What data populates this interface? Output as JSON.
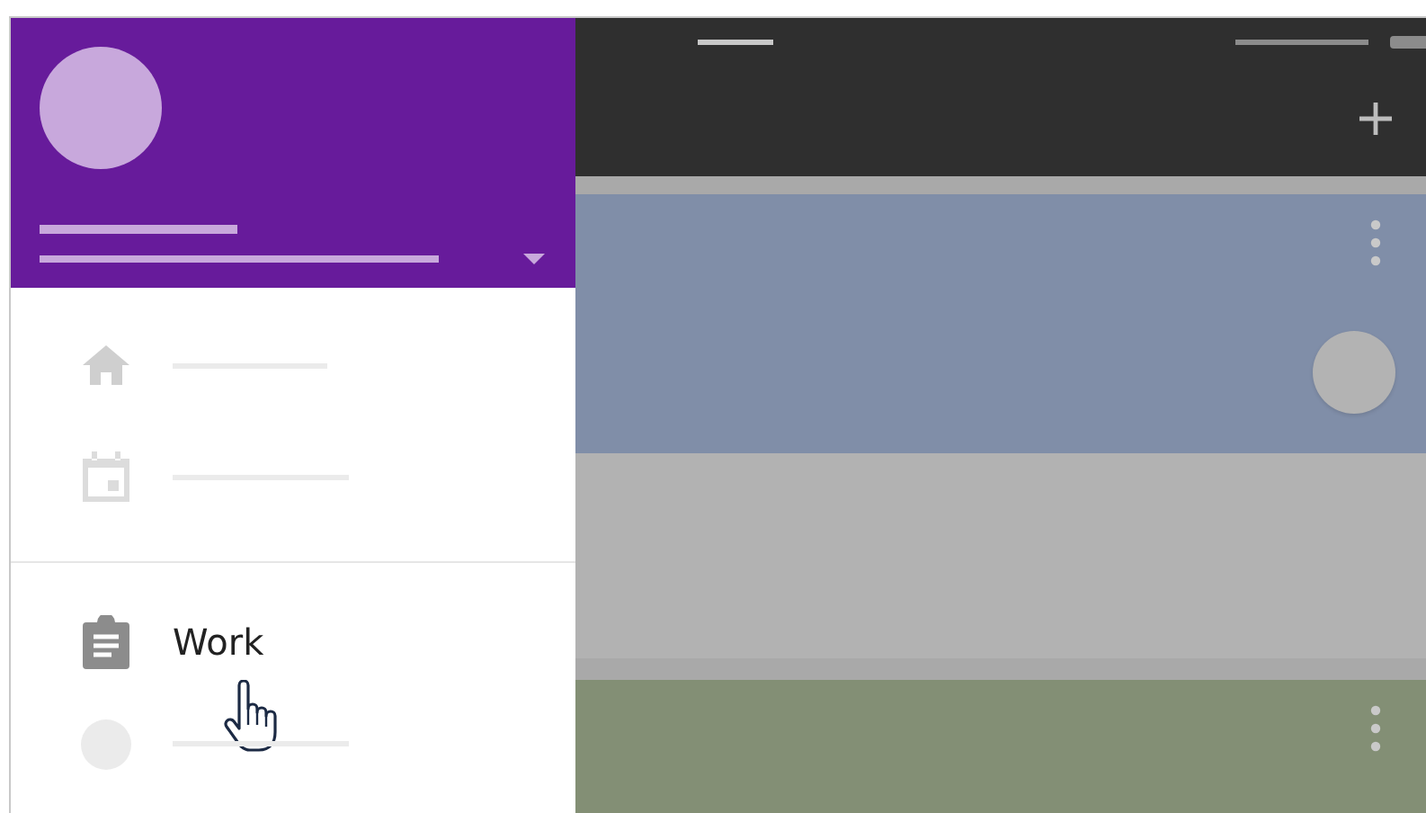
{
  "drawer": {
    "sections": [
      {
        "items": [
          {
            "kind": "home"
          },
          {
            "kind": "calendar"
          }
        ]
      },
      {
        "items": [
          {
            "kind": "clipboard",
            "label": "Work",
            "hovered": true
          },
          {
            "kind": "dot"
          }
        ]
      }
    ]
  },
  "cards": [
    {
      "color": "#808ea8",
      "menu": true,
      "avatar": true
    },
    {
      "color": "#b2b2b2",
      "menu": false,
      "avatar": false
    },
    {
      "color": "#838f75",
      "menu": true,
      "avatar": false
    }
  ]
}
